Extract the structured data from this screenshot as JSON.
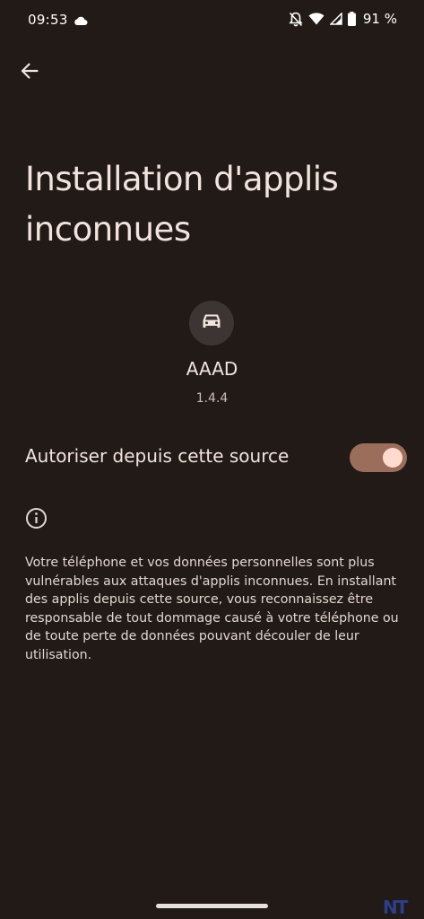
{
  "status_bar": {
    "time": "09:53",
    "battery_percent": "91 %",
    "icons": [
      "cloud-icon",
      "notifications-off-icon",
      "wifi-icon",
      "signal-icon",
      "battery-icon"
    ]
  },
  "header": {
    "back_icon": "arrow-left-icon",
    "title": "Installation d'applis inconnues"
  },
  "app": {
    "icon": "car-icon",
    "name": "AAAD",
    "version": "1.4.4"
  },
  "setting": {
    "label": "Autoriser depuis cette source",
    "enabled": true
  },
  "info": {
    "icon": "info-icon",
    "text": "Votre téléphone et vos données personnelles sont plus vulnérables aux attaques d'applis inconnues. En installant des applis depuis cette source, vous reconnaissez être responsable de tout dommage causé à votre téléphone ou de toute perte de données pouvant découler de leur utilisation."
  },
  "colors": {
    "background": "#211a17",
    "toggle_track": "#9a6e5a",
    "toggle_thumb": "#ffdbcf",
    "text": "#f2e3dd"
  },
  "watermark": "NT"
}
